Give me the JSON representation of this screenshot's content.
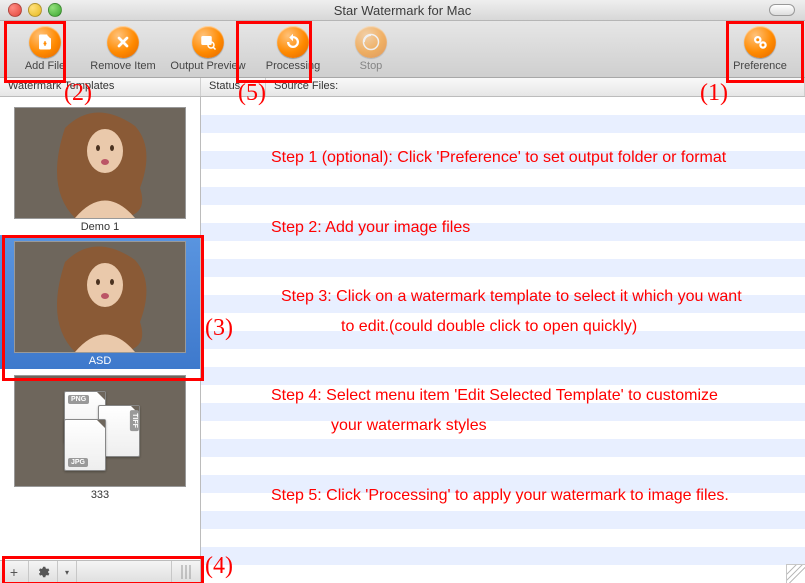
{
  "window": {
    "title": "Star Watermark for Mac"
  },
  "toolbar": {
    "add_file": "Add File",
    "remove_item": "Remove Item",
    "output_preview": "Output Preview",
    "processing": "Processing",
    "stop": "Stop",
    "preference": "Preference"
  },
  "column_headers": {
    "templates": "Watermark Templates",
    "status": "Status",
    "source": "Source Files:"
  },
  "templates": [
    {
      "label": "Demo 1",
      "selected": false,
      "kind": "portrait"
    },
    {
      "label": "ASD",
      "selected": true,
      "kind": "portrait"
    },
    {
      "label": "333",
      "selected": false,
      "kind": "filetypes"
    }
  ],
  "filetype_tags": {
    "top": "PNG",
    "right": "TIFF",
    "bottom": "JPG"
  },
  "bottom_bar": {
    "add": "+",
    "settings": "✻",
    "dropdown": "▾"
  },
  "steps": {
    "s1": "Step 1 (optional): Click 'Preference' to set output folder or format",
    "s2": "Step 2: Add your image files",
    "s3_line1": "Step 3: Click on a watermark template to select it which you want",
    "s3_line2": "to edit.(could double click to open quickly)",
    "s4_line1": "Step 4: Select menu item 'Edit Selected Template' to customize",
    "s4_line2": "your watermark styles",
    "s5": "Step 5: Click 'Processing' to apply your watermark to image files."
  },
  "annotations": {
    "a1": "(1)",
    "a2": "(2)",
    "a3": "(3)",
    "a4": "(4)",
    "a5": "(5)"
  }
}
